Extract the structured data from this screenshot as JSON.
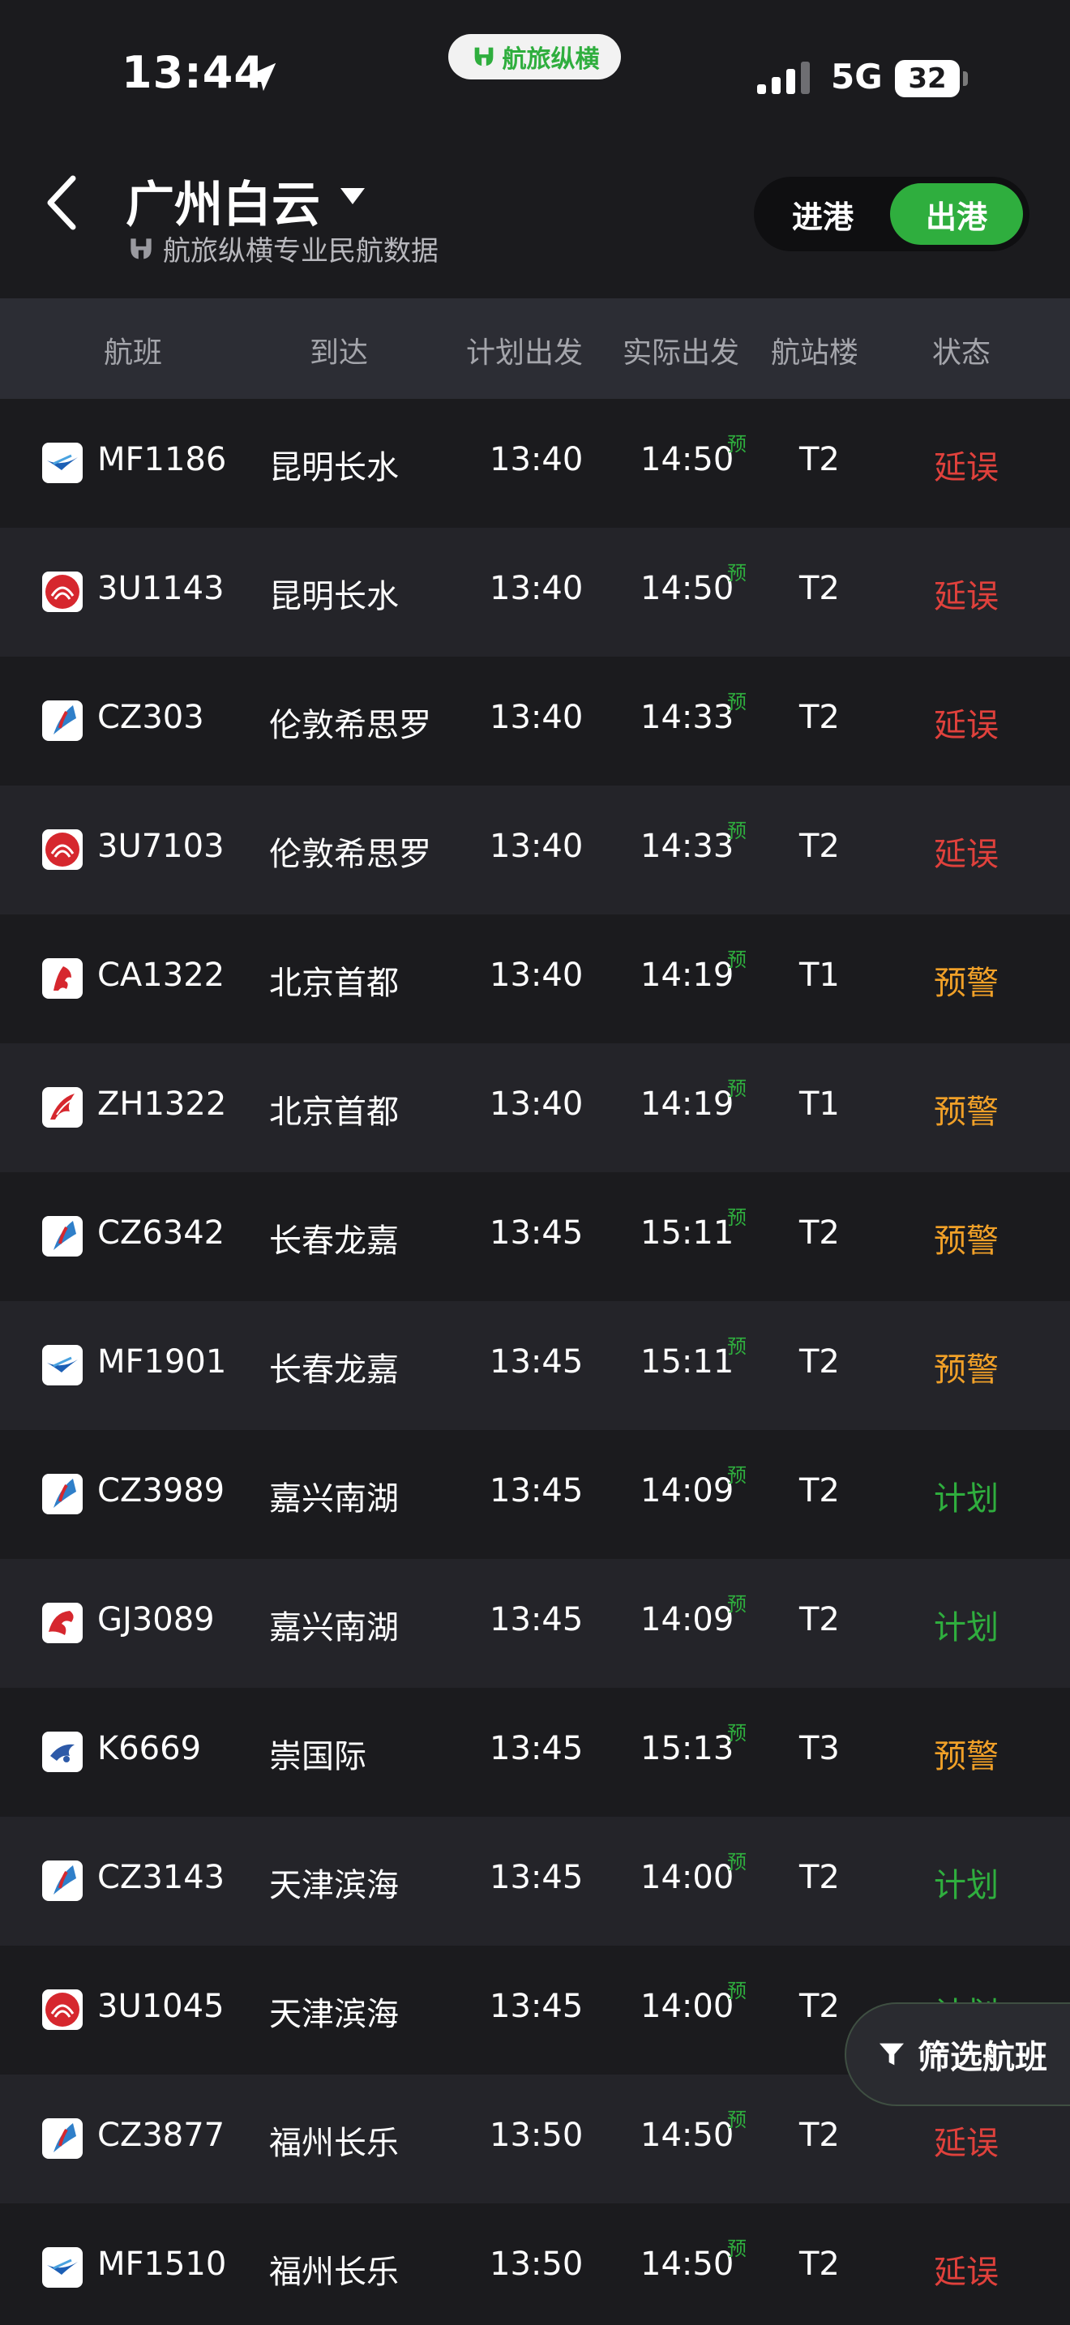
{
  "status_bar": {
    "time": "13:44",
    "brand": "航旅纵横",
    "network": "5G",
    "battery": "32",
    "icons": [
      "location-arrow-icon",
      "signal-bars-icon",
      "battery-icon"
    ]
  },
  "header": {
    "airport": "广州白云",
    "subtitle": "航旅纵横专业民航数据",
    "tabs": {
      "arrivals": "进港",
      "departures": "出港",
      "selected": "departures"
    }
  },
  "columns": [
    "航班",
    "到达",
    "计划出发",
    "实际出发",
    "航站楼",
    "状态"
  ],
  "status_colors": {
    "延误": "#e0413c",
    "预警": "#f0a028",
    "计划": "#2fae3e"
  },
  "pre_label": "预",
  "flights": [
    {
      "flight": "MF1186",
      "dest": "昆明长水",
      "sched": "13:40",
      "actual": "14:50",
      "terminal": "T2",
      "status": "延误",
      "airline_icon": "xiamen-airlines-icon"
    },
    {
      "flight": "3U1143",
      "dest": "昆明长水",
      "sched": "13:40",
      "actual": "14:50",
      "terminal": "T2",
      "status": "延误",
      "airline_icon": "sichuan-airlines-icon"
    },
    {
      "flight": "CZ303",
      "dest": "伦敦希思罗",
      "sched": "13:40",
      "actual": "14:33",
      "terminal": "T2",
      "status": "延误",
      "airline_icon": "china-southern-icon"
    },
    {
      "flight": "3U7103",
      "dest": "伦敦希思罗",
      "sched": "13:40",
      "actual": "14:33",
      "terminal": "T2",
      "status": "延误",
      "airline_icon": "sichuan-airlines-icon"
    },
    {
      "flight": "CA1322",
      "dest": "北京首都",
      "sched": "13:40",
      "actual": "14:19",
      "terminal": "T1",
      "status": "预警",
      "airline_icon": "air-china-icon"
    },
    {
      "flight": "ZH1322",
      "dest": "北京首都",
      "sched": "13:40",
      "actual": "14:19",
      "terminal": "T1",
      "status": "预警",
      "airline_icon": "shenzhen-airlines-icon"
    },
    {
      "flight": "CZ6342",
      "dest": "长春龙嘉",
      "sched": "13:45",
      "actual": "15:11",
      "terminal": "T2",
      "status": "预警",
      "airline_icon": "china-southern-icon"
    },
    {
      "flight": "MF1901",
      "dest": "长春龙嘉",
      "sched": "13:45",
      "actual": "15:11",
      "terminal": "T2",
      "status": "预警",
      "airline_icon": "xiamen-airlines-icon"
    },
    {
      "flight": "CZ3989",
      "dest": "嘉兴南湖",
      "sched": "13:45",
      "actual": "14:09",
      "terminal": "T2",
      "status": "计划",
      "airline_icon": "china-southern-icon"
    },
    {
      "flight": "GJ3089",
      "dest": "嘉兴南湖",
      "sched": "13:45",
      "actual": "14:09",
      "terminal": "T2",
      "status": "计划",
      "airline_icon": "loong-air-icon"
    },
    {
      "flight": "K6669",
      "dest": "崇国际",
      "sched": "13:45",
      "actual": "15:13",
      "terminal": "T3",
      "status": "预警",
      "airline_icon": "cambodia-angkor-air-icon"
    },
    {
      "flight": "CZ3143",
      "dest": "天津滨海",
      "sched": "13:45",
      "actual": "14:00",
      "terminal": "T2",
      "status": "计划",
      "airline_icon": "china-southern-icon"
    },
    {
      "flight": "3U1045",
      "dest": "天津滨海",
      "sched": "13:45",
      "actual": "14:00",
      "terminal": "T2",
      "status": "计划",
      "airline_icon": "sichuan-airlines-icon"
    },
    {
      "flight": "CZ3877",
      "dest": "福州长乐",
      "sched": "13:50",
      "actual": "14:50",
      "terminal": "T2",
      "status": "延误",
      "airline_icon": "china-southern-icon"
    },
    {
      "flight": "MF1510",
      "dest": "福州长乐",
      "sched": "13:50",
      "actual": "14:50",
      "terminal": "T2",
      "status": "延误",
      "airline_icon": "xiamen-airlines-icon"
    }
  ],
  "filter_button": {
    "label": "筛选航班",
    "icon": "filter-funnel-icon"
  }
}
